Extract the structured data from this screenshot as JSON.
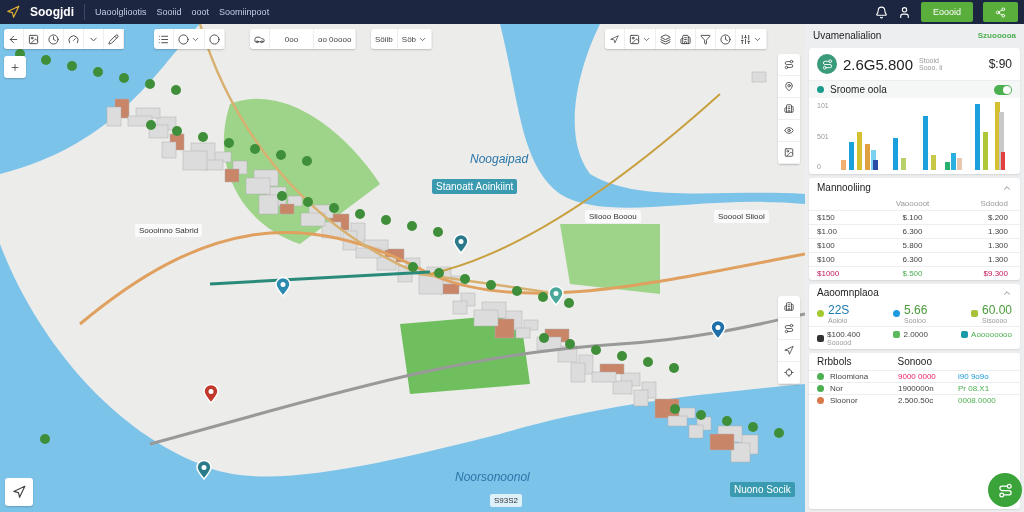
{
  "app": {
    "name": "Soogjdi",
    "nav": [
      "Uaoolgliootis",
      "Sooiid",
      "ooot",
      "Soomiinpoot"
    ],
    "action_button": "Eoooid"
  },
  "map": {
    "toolbar_texts": [
      "0oo",
      "oo 0oooo",
      "Söiib",
      "Söb"
    ],
    "labels": [
      {
        "kind": "water",
        "text": "Noogaipad"
      },
      {
        "kind": "chip",
        "text": "Stanoatt Aoinkiint"
      },
      {
        "kind": "place",
        "text": "Soooinno Sabrid"
      },
      {
        "kind": "place",
        "text": "Sliooo Booou"
      },
      {
        "kind": "place",
        "text": "Sooool Siiool"
      },
      {
        "kind": "water",
        "text": "Noorsonoonol"
      },
      {
        "kind": "chip",
        "text": "Nuono Socik"
      },
      {
        "kind": "place",
        "text": "S93S2"
      }
    ]
  },
  "panel": {
    "title": "Uvamenalialion",
    "link": "Szuooooa",
    "summary": {
      "value": "2.6G5.800",
      "sub": [
        "Stooid",
        "Sooo. ii"
      ],
      "amount": "$:90"
    },
    "chart_section": {
      "title": "Sroome oola",
      "on": true,
      "y_labels": [
        "101",
        "501",
        "0"
      ]
    },
    "table": {
      "title": "Mannooliing",
      "expanded": true,
      "columns": [
        "",
        "Vaooooot",
        "Sdodod"
      ],
      "rows": [
        [
          "$150",
          "$.100",
          "$.200"
        ],
        [
          "$1.00",
          "6.300",
          "1.300"
        ],
        [
          "$100",
          "5.800",
          "1.300"
        ],
        [
          "$100",
          "6.300",
          "1.300"
        ]
      ],
      "total": [
        "$1000",
        "$.500",
        "$9.300"
      ]
    },
    "stats": {
      "title": "Aaoomnplaoa",
      "expanded": true,
      "items": [
        {
          "value": "22S",
          "label": "Aoioio",
          "color": "#a3c92c"
        },
        {
          "value": "5.66",
          "label": "Sooioo",
          "color": "#1e9be0"
        },
        {
          "value": "60.00",
          "label": "Sisoooo",
          "color": "#a8c23a"
        }
      ],
      "extra": [
        {
          "value": "$100.400",
          "label": "Sooood",
          "color": "#333333"
        },
        {
          "value": "2.0000",
          "color": "#5cb85c"
        },
        {
          "value": "Aoooooooo",
          "color": "#1a9aa8"
        }
      ]
    },
    "legend": {
      "title": "Rrbbols",
      "column": "Sonooo",
      "rows": [
        {
          "name": "Rloomiona",
          "color": "#4caf50",
          "value": "9000 0000",
          "note": "i90 9o9o"
        },
        {
          "name": "Nor",
          "color": "#4caf50",
          "value": "1900000n",
          "note": "Pr 08.X1"
        },
        {
          "name": "Sloonor",
          "color": "#d9794a",
          "value": "2.500.50c",
          "note": "0008.0000"
        }
      ]
    }
  }
}
